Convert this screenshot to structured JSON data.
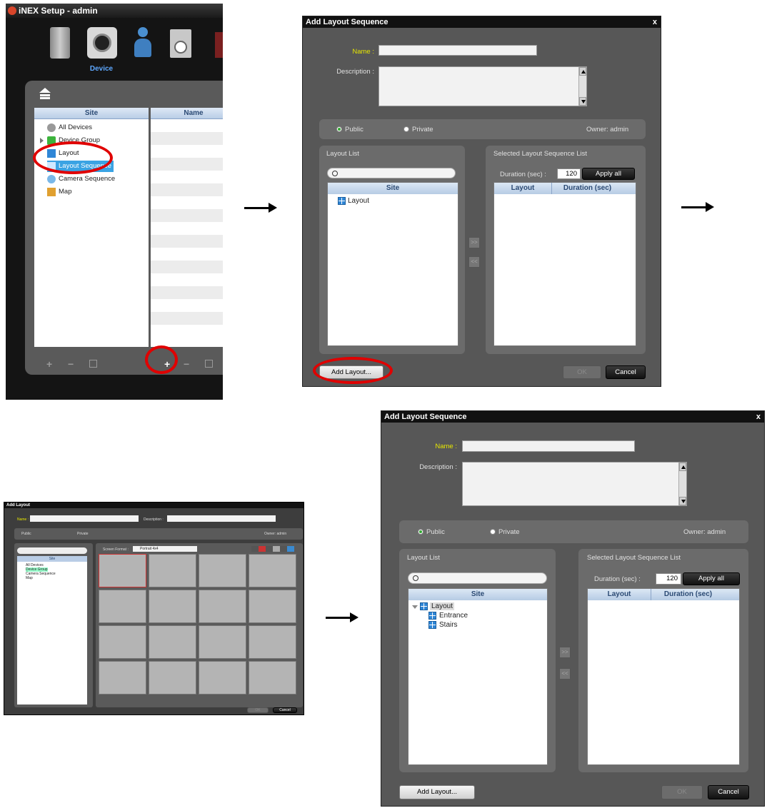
{
  "setup": {
    "title": "iNEX Setup - admin",
    "device_label": "Device",
    "site_header": "Site",
    "name_header": "Name",
    "tree": [
      "All Devices",
      "Device Group",
      "Layout",
      "Layout Sequence",
      "Camera Sequence",
      "Map"
    ]
  },
  "dialog1": {
    "title": "Add Layout Sequence",
    "close": "x",
    "name_label": "Name :",
    "description_label": "Description :",
    "public_label": "Public",
    "private_label": "Private",
    "owner_label": "Owner: admin",
    "layout_list_label": "Layout List",
    "selected_list_label": "Selected Layout Sequence List",
    "duration_label": "Duration (sec) :",
    "duration_value": "120",
    "apply_all": "Apply all",
    "site_header": "Site",
    "layout_header": "Layout",
    "duration_header": "Duration (sec)",
    "tree": [
      "Layout"
    ],
    "move_right": ">>",
    "move_left": "<<",
    "add_layout": "Add Layout...",
    "ok": "OK",
    "cancel": "Cancel"
  },
  "dialog2": {
    "title": "Add Layout Sequence",
    "close": "x",
    "name_label": "Name :",
    "description_label": "Description :",
    "public_label": "Public",
    "private_label": "Private",
    "owner_label": "Owner: admin",
    "layout_list_label": "Layout List",
    "selected_list_label": "Selected Layout Sequence List",
    "duration_label": "Duration (sec) :",
    "duration_value": "120",
    "apply_all": "Apply all",
    "site_header": "Site",
    "layout_header": "Layout",
    "duration_header": "Duration (sec)",
    "tree": [
      "Layout",
      "Entrance",
      "Stairs"
    ],
    "move_right": ">>",
    "move_left": "<<",
    "add_layout": "Add Layout...",
    "ok": "OK",
    "cancel": "Cancel"
  },
  "mini": {
    "title": "Add Layout",
    "name_label": "Name :",
    "description_label": "Description :",
    "public_label": "Public",
    "private_label": "Private",
    "owner_label": "Owner: admin",
    "site_header": "Site",
    "screen_format_label": "Screen Format :",
    "screen_format_value": "Portrait 4x4",
    "tree": [
      "All Devices",
      "Device Group",
      "Camera Sequence",
      "Map"
    ],
    "ok": "OK",
    "cancel": "Cancel"
  },
  "colors": {
    "accent_red": "#e00000",
    "selection_blue": "#3aa3e3",
    "dialog_bg": "#575757",
    "label_yellow": "#e6e600"
  },
  "icons": [
    "arrow-right-icon",
    "plus-icon",
    "minus-icon",
    "edit-icon",
    "search-icon",
    "layout-icon",
    "device-icon",
    "user-icon"
  ]
}
